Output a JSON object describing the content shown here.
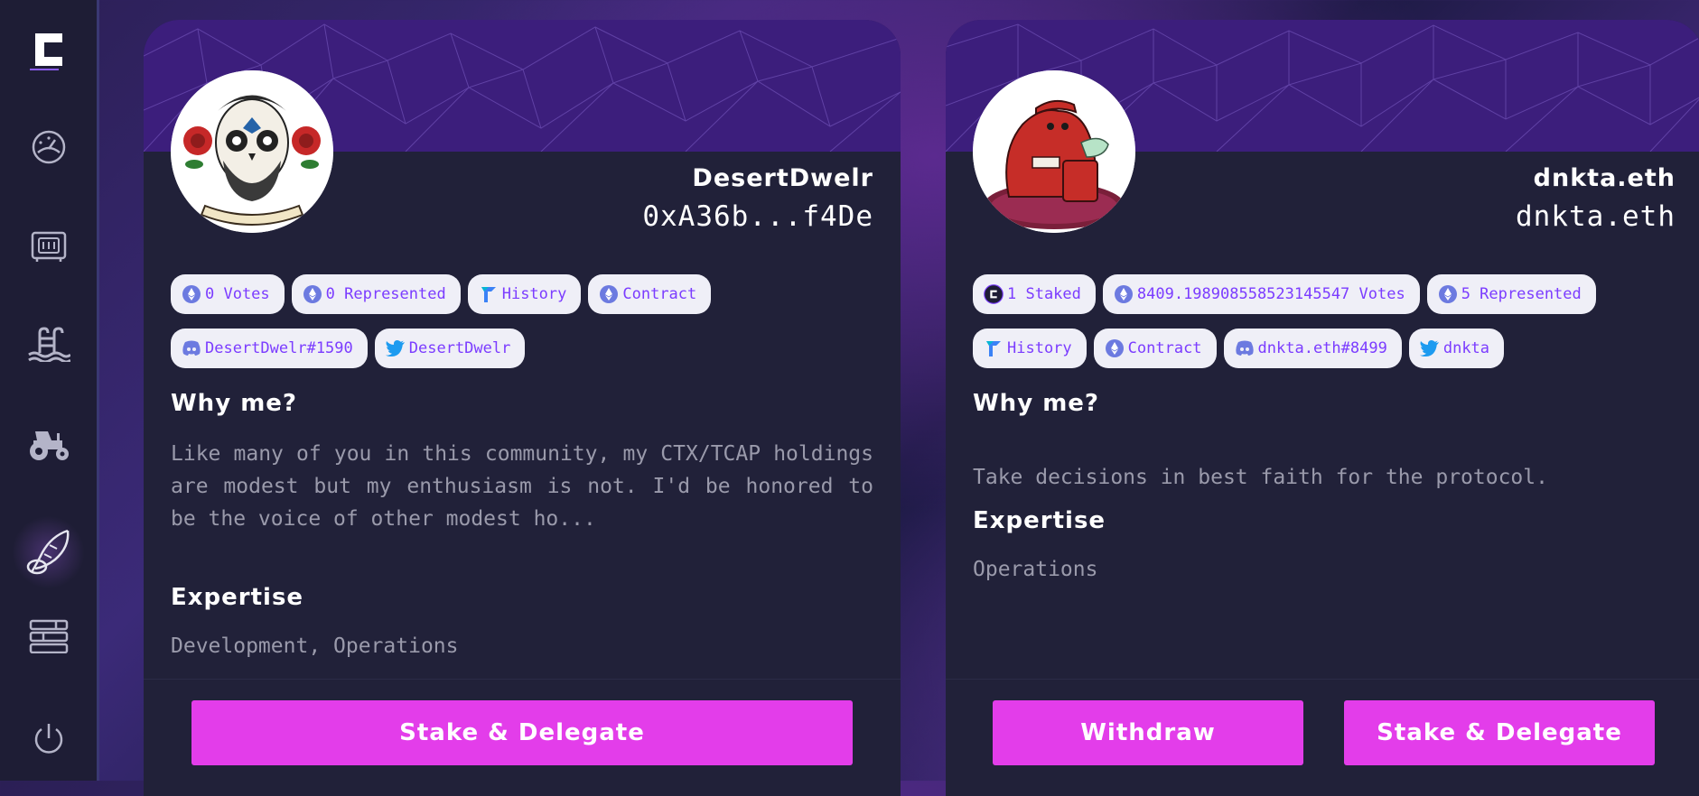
{
  "sidebar": {
    "items": [
      {
        "icon": "dashboard-gauge-icon"
      },
      {
        "icon": "vault-icon"
      },
      {
        "icon": "pool-icon"
      },
      {
        "icon": "tractor-farm-icon"
      },
      {
        "icon": "governance-feather-icon",
        "active": true
      },
      {
        "icon": "sushi-layers-icon"
      }
    ],
    "power_icon": "power-icon"
  },
  "cards": [
    {
      "name": "DesertDwelr",
      "address": "0xA36b...f4De",
      "chips_row1": [
        {
          "label": "0 Votes",
          "icon": "eth-icon"
        },
        {
          "label": "0 Represented",
          "icon": "eth-icon"
        },
        {
          "label": "History",
          "icon": "tally-icon"
        },
        {
          "label": "Contract",
          "icon": "eth-icon"
        }
      ],
      "chips_row2": [
        {
          "label": "DesertDwelr#1590",
          "icon": "discord-icon"
        },
        {
          "label": "DesertDwelr",
          "icon": "twitter-icon"
        }
      ],
      "why_title": "Why me?",
      "why_text": "Like many of you in this community, my CTX/TCAP holdings are modest but my enthusiasm is not. I'd be honored to be the voice of other modest ho...",
      "expertise_title": "Expertise",
      "expertise_text": "Development, Operations",
      "buttons": {
        "stake": "Stake & Delegate"
      }
    },
    {
      "name": "dnkta.eth",
      "address": "dnkta.eth",
      "chips_row1": [
        {
          "label": "1 Staked",
          "icon": "ctx-icon"
        },
        {
          "label": "8409.198908558523145547 Votes",
          "icon": "eth-icon"
        },
        {
          "label": "5 Represented",
          "icon": "eth-icon"
        }
      ],
      "chips_row2": [
        {
          "label": "History",
          "icon": "tally-icon"
        },
        {
          "label": "Contract",
          "icon": "eth-icon"
        },
        {
          "label": "dnkta.eth#8499",
          "icon": "discord-icon"
        },
        {
          "label": "dnkta",
          "icon": "twitter-icon"
        }
      ],
      "why_title": "Why me?",
      "why_text": "Take decisions in best faith for the protocol.",
      "expertise_title": "Expertise",
      "expertise_text": "Operations",
      "buttons": {
        "withdraw": "Withdraw",
        "stake": "Stake & Delegate"
      }
    }
  ],
  "colors": {
    "accent": "#e33dea",
    "chip_text": "#7b3cff",
    "card_bg": "#212139",
    "banner": "#3b1f7a"
  }
}
